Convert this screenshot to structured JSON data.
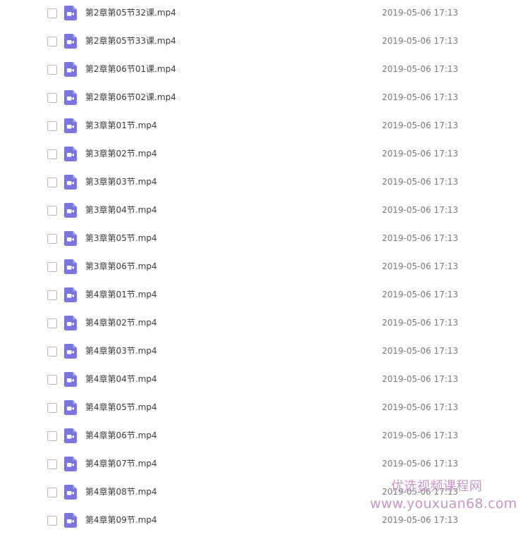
{
  "files": [
    {
      "name": "第2章第05节32课.mp4",
      "date": "2019-05-06 17:13",
      "icon": "video-file-icon"
    },
    {
      "name": "第2章第05节33课.mp4",
      "date": "2019-05-06 17:13",
      "icon": "video-file-icon"
    },
    {
      "name": "第2章第06节01课.mp4",
      "date": "2019-05-06 17:13",
      "icon": "video-file-icon"
    },
    {
      "name": "第2章第06节02课.mp4",
      "date": "2019-05-06 17:13",
      "icon": "video-file-icon"
    },
    {
      "name": "第3章第01节.mp4",
      "date": "2019-05-06 17:13",
      "icon": "video-file-icon"
    },
    {
      "name": "第3章第02节.mp4",
      "date": "2019-05-06 17:13",
      "icon": "video-file-icon"
    },
    {
      "name": "第3章第03节.mp4",
      "date": "2019-05-06 17:13",
      "icon": "video-file-icon"
    },
    {
      "name": "第3章第04节.mp4",
      "date": "2019-05-06 17:13",
      "icon": "video-file-icon"
    },
    {
      "name": "第3章第05节.mp4",
      "date": "2019-05-06 17:13",
      "icon": "video-file-icon"
    },
    {
      "name": "第3章第06节.mp4",
      "date": "2019-05-06 17:13",
      "icon": "video-file-icon"
    },
    {
      "name": "第4章第01节.mp4",
      "date": "2019-05-06 17:13",
      "icon": "video-file-icon"
    },
    {
      "name": "第4章第02节.mp4",
      "date": "2019-05-06 17:13",
      "icon": "video-file-icon"
    },
    {
      "name": "第4章第03节.mp4",
      "date": "2019-05-06 17:13",
      "icon": "video-file-icon"
    },
    {
      "name": "第4章第04节.mp4",
      "date": "2019-05-06 17:13",
      "icon": "video-file-icon"
    },
    {
      "name": "第4章第05节.mp4",
      "date": "2019-05-06 17:13",
      "icon": "video-file-icon"
    },
    {
      "name": "第4章第06节.mp4",
      "date": "2019-05-06 17:13",
      "icon": "video-file-icon"
    },
    {
      "name": "第4章第07节.mp4",
      "date": "2019-05-06 17:13",
      "icon": "video-file-icon"
    },
    {
      "name": "第4章第08节.mp4",
      "date": "2019-05-06 17:13",
      "icon": "video-file-icon"
    },
    {
      "name": "第4章第09节.mp4",
      "date": "2019-05-06 17:13",
      "icon": "video-file-icon"
    }
  ],
  "watermark": {
    "title": "优选视频课程网",
    "url": "www.youxuan68.com"
  },
  "colors": {
    "icon_fill": "#7b74de",
    "watermark": "#c594c5",
    "text": "#3b3b3b",
    "date_text": "#7a7a7a"
  }
}
